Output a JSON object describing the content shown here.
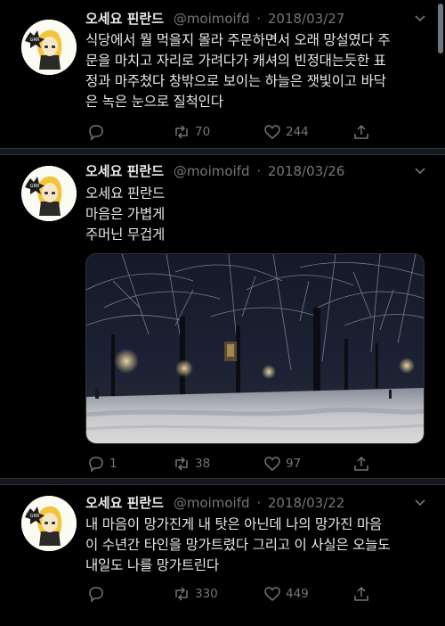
{
  "tweets": [
    {
      "name": "오세요 핀란드",
      "handle": "@moimoifd",
      "separator": "·",
      "date": "2018/03/27",
      "lines": [
        "식당에서 뭘 먹을지 몰라 주문하면서 오래 망설였다 주",
        "문을 마치고 자리로 가려다가 캐셔의 빈정대는듯한 표",
        "정과 마주쳤다 창밖으로 보이는 하늘은 잿빛이고 바닥",
        "은 녹은 눈으로 질척인다"
      ],
      "replies": "",
      "retweets": "70",
      "likes": "244"
    },
    {
      "name": "오세요 핀란드",
      "handle": "@moimoifd",
      "separator": "·",
      "date": "2018/03/26",
      "lines": [
        "오세요 핀란드",
        "마음은 가볍게",
        "주머닌 무겁게"
      ],
      "replies": "1",
      "retweets": "38",
      "likes": "97",
      "photo": "snowy-park-at-night"
    },
    {
      "name": "오세요 핀란드",
      "handle": "@moimoifd",
      "separator": "·",
      "date": "2018/03/22",
      "lines": [
        "내 마음이 망가진게 내 탓은 아닌데 나의 망가진 마음",
        "이 수년간 타인을 망가트렸다 그리고 이 사실은 오늘도",
        "내일도 나를 망가트린다"
      ],
      "replies": "",
      "retweets": "330",
      "likes": "449"
    }
  ],
  "icons": {
    "reply": "reply-icon",
    "retweet": "retweet-icon",
    "like": "heart-icon",
    "share": "share-icon",
    "more": "chevron-down-icon"
  },
  "colors": {
    "background": "#000000",
    "text": "#e7e9ea",
    "secondary": "#71767b",
    "divider": "#15181c"
  }
}
